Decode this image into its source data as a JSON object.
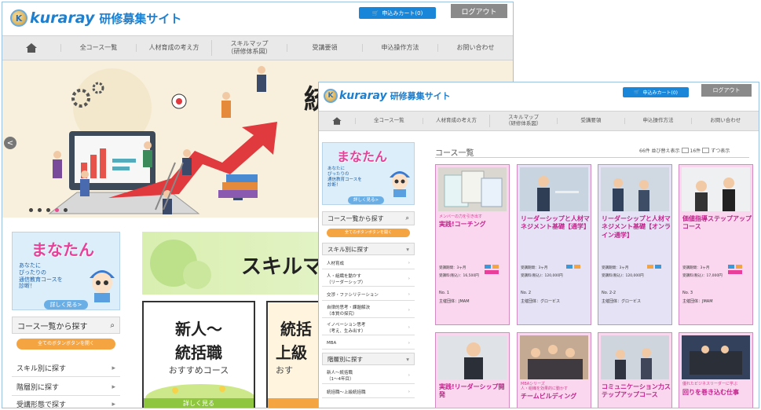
{
  "header": {
    "logo_mark": "K",
    "logo_word": "kuraray",
    "logo_site": "研修募集サイト",
    "cart_label": "申込みカート(0)",
    "logout_label": "ログアウト"
  },
  "nav": {
    "items": [
      "全コース一覧",
      "人材育成の考え方",
      "スキルマップ\n（研修体系図）",
      "受講要領",
      "申込操作方法",
      "お問い合わせ"
    ]
  },
  "hero": {
    "title": "統括職",
    "prev_arrow": "<"
  },
  "manatan": {
    "title": "まなたん",
    "text": "あなたに\nぴったりの\n通信教育コースを\n診断！",
    "link": "詳しく見る>"
  },
  "sidebar": {
    "search_label": "コース一覧から探す",
    "quick_button": "全てのボタンボタンを開く",
    "skill_label": "スキル別に探す",
    "level_label": "階層別に探す",
    "history_label": "受講形態で探す",
    "skill_items": [
      "人材育成",
      "人・組織を動かす\n（リーダーシップ）",
      "交渉・ファシリテーション",
      "自律的思考・課題解決\n（本質の探究）",
      "イノベーション思考\n（考え、生み出す）",
      "MBA"
    ],
    "level_items": [
      "新人～統括職\n（1～4年目）",
      "統括職～上級統括職"
    ]
  },
  "banners": {
    "skill_map": "スキルマ",
    "card1_l1": "新人～",
    "card1_l2": "統括職",
    "card1_sub": "おすすめコース",
    "card1_foot": "詳しく見る",
    "card2_l1": "統括",
    "card2_l2": "上級",
    "card2_sub": "おす"
  },
  "list": {
    "title": "コース一覧",
    "sort_text": "66件 並び替え表示",
    "per_page": "16件",
    "per_page_suffix": "ずつ表示"
  },
  "courses": [
    {
      "tag": "メンバーの力を引き出す",
      "title": "実践!コーチング",
      "period": "受講期間：3ヶ月",
      "price": "受講料(税込)：16,500円",
      "no": "No. 1",
      "company": "主催団体：JMAM"
    },
    {
      "tag": "",
      "title": "リーダーシップと人材マネジメント基礎【通学】",
      "period": "受講期間：3ヶ月",
      "price": "受講料(税込)：120,000円",
      "no": "No. 2",
      "company": "主催団体：グロービス"
    },
    {
      "tag": "",
      "title": "リーダーシップと人材マネジメント基礎【オンライン通学】",
      "period": "受講期間：3ヶ月",
      "price": "受講料(税込)：120,000円",
      "no": "No. 2-2",
      "company": "主催団体：グロービス"
    },
    {
      "tag": "",
      "title": "価値指導ステップアップコース",
      "period": "受講期間：3ヶ月",
      "price": "受講料(税込)：17,000円",
      "no": "No. 3",
      "company": "主催団体：JMAM"
    }
  ],
  "courses_row2": [
    {
      "tag": "",
      "title": "実践!リーダーシップ開発"
    },
    {
      "tag": "MBAシリーズ\n人・組織を効果的に動かす",
      "title": "チームビルディング"
    },
    {
      "tag": "",
      "title": "コミュニケーション力ステップアップコース"
    },
    {
      "tag": "優れたビジネスリーダーに学ぶ",
      "title": "回りを巻き込む仕事"
    }
  ],
  "colors": {
    "brand_blue": "#1d7fd0",
    "accent_pink": "#e8409a",
    "orange": "#f5a442",
    "card_pink": "#fbd7ef",
    "card_lavender": "#e6e2f6"
  }
}
